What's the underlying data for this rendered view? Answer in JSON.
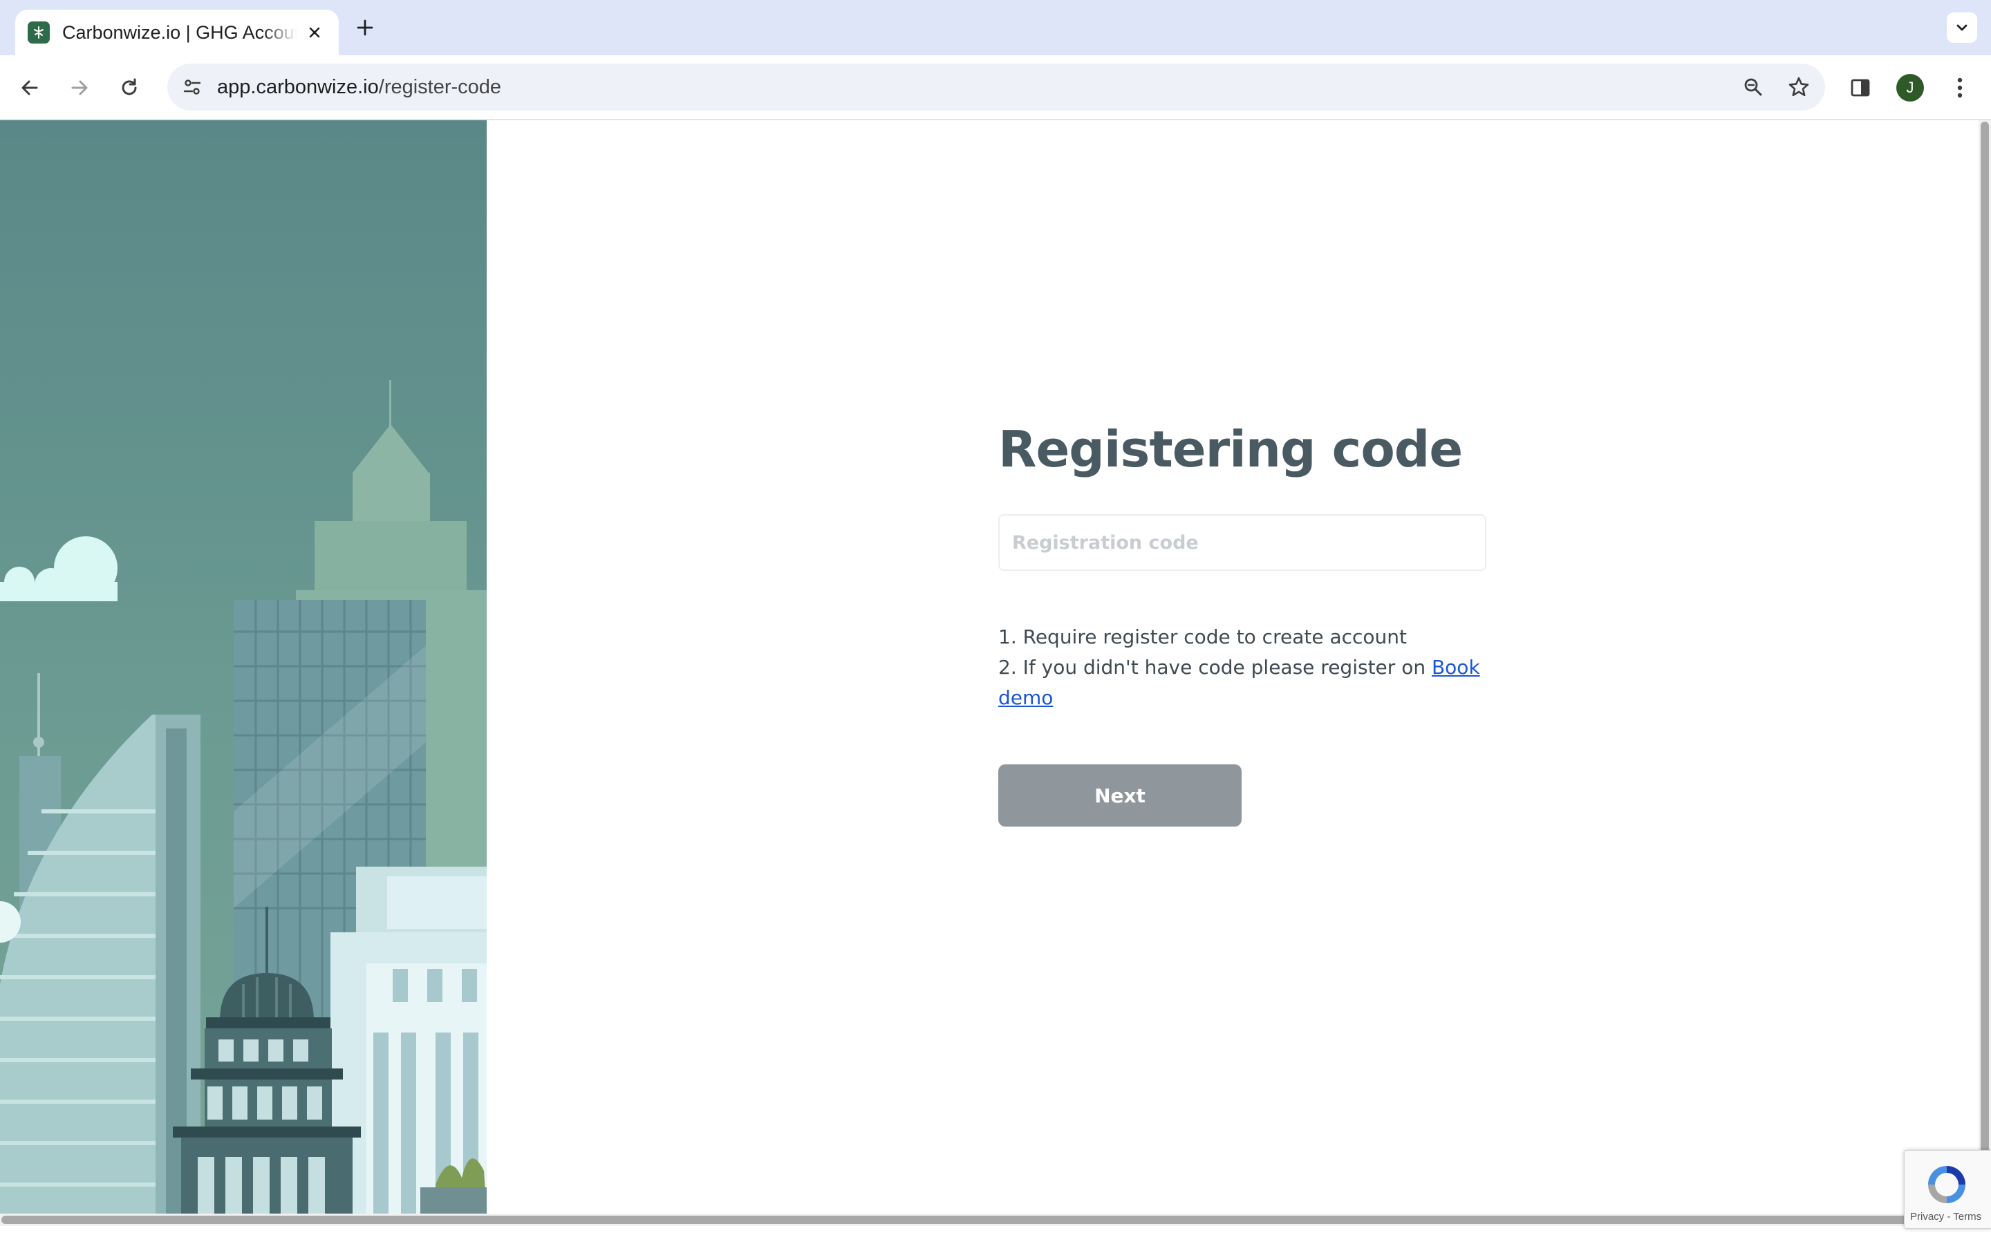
{
  "browser": {
    "tab_title": "Carbonwize.io | GHG Accounting",
    "url_host": "app.carbonwize.io",
    "url_path": "/register-code",
    "profile_initial": "J"
  },
  "page": {
    "heading": "Registering code",
    "input_placeholder": "Registration code",
    "notes": {
      "line1": "1. Require register code to create account",
      "line2_prefix": "2. If you didn't have code please register on ",
      "book_demo_link": "Book demo"
    },
    "next_button": "Next"
  },
  "recaptcha": {
    "links": "Privacy - Terms"
  },
  "colors": {
    "heading": "#4a5a63",
    "button_disabled": "#8f979d",
    "link": "#1a56d6",
    "sky": "#5a8a8a"
  }
}
